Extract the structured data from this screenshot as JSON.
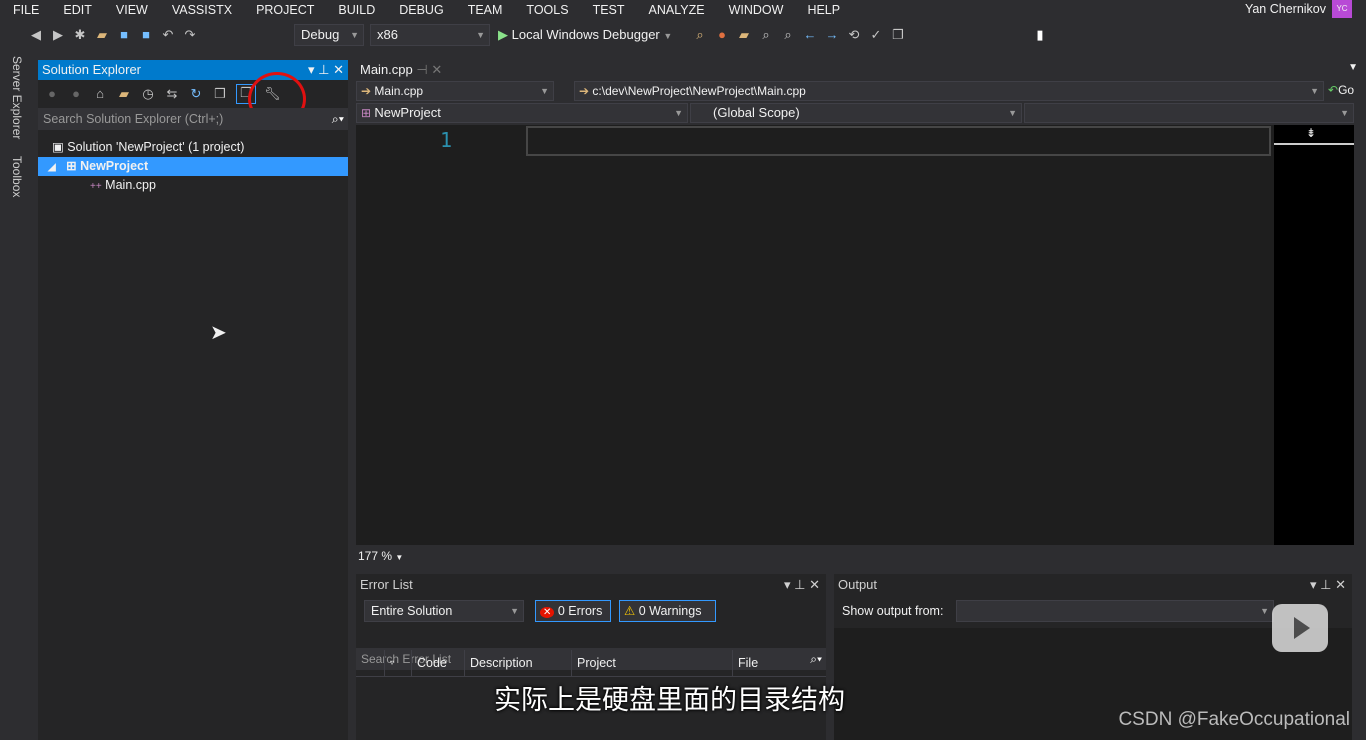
{
  "menu": [
    "FILE",
    "EDIT",
    "VIEW",
    "VASSISTX",
    "PROJECT",
    "BUILD",
    "DEBUG",
    "TEAM",
    "TOOLS",
    "TEST",
    "ANALYZE",
    "WINDOW",
    "HELP"
  ],
  "user": {
    "name": "Yan Chernikov",
    "initials": "YC"
  },
  "toolbar": {
    "config": "Debug",
    "platform": "x86",
    "debugger": "Local Windows Debugger"
  },
  "side_tabs": [
    "Server Explorer",
    "Toolbox"
  ],
  "solution_explorer": {
    "title": "Solution Explorer",
    "search_placeholder": "Search Solution Explorer (Ctrl+;)",
    "tree": [
      "Solution 'NewProject' (1 project)",
      "NewProject",
      "Main.cpp"
    ]
  },
  "editor": {
    "tab": "Main.cpp",
    "nav_file": "Main.cpp",
    "nav_path": "c:\\dev\\NewProject\\NewProject\\Main.cpp",
    "go": "Go",
    "project": "NewProject",
    "scope": "(Global Scope)",
    "line_number": "1",
    "zoom": "177 %"
  },
  "error_list": {
    "title": "Error List",
    "scope": "Entire Solution",
    "errors": "0 Errors",
    "warnings": "0 Warnings",
    "search_placeholder": "Search Error List",
    "columns": [
      "Code",
      "Description",
      "Project",
      "File"
    ]
  },
  "output": {
    "title": "Output",
    "show_from": "Show output from:"
  },
  "subtitle": "实际上是硬盘里面的目录结构",
  "watermark": "CSDN @FakeOccupational",
  "colors": {
    "accent": "#007acc",
    "selection": "#3399ff",
    "line_number": "#2b91af",
    "highlight_circle": "#e01010"
  }
}
